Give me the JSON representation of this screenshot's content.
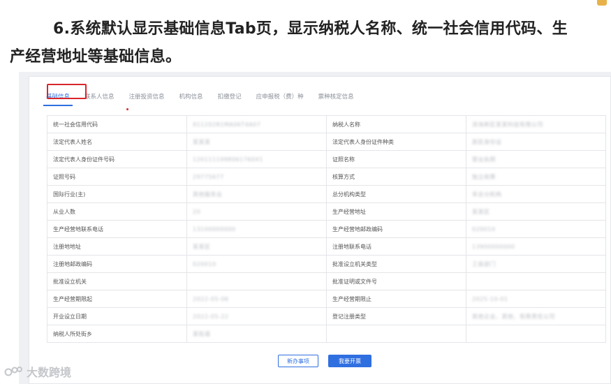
{
  "heading": {
    "line1": "6.系统默认显示基础信息Tab页，显示纳税人名称、统一社会信用代码、生",
    "line2": "产经营地址等基础信息。"
  },
  "tabs": [
    {
      "label": "基础信息",
      "active": true
    },
    {
      "label": "联系人信息",
      "active": false
    },
    {
      "label": "注册投资信息",
      "active": false
    },
    {
      "label": "机构信息",
      "active": false
    },
    {
      "label": "扣缴登记",
      "active": false
    },
    {
      "label": "应申报税（费）种",
      "active": false
    },
    {
      "label": "票种核定信息",
      "active": false
    }
  ],
  "table": {
    "rows": [
      {
        "l1": "统一社会信用代码",
        "v1": "91120281MA06T4A07",
        "l2": "纳税人名称",
        "v2": "滨海新区某某科技有限公司"
      },
      {
        "l1": "法定代表人姓名",
        "v1": "某某某",
        "l2": "法定代表人身份证件种类",
        "v2": "居民身份证"
      },
      {
        "l1": "法定代表人身份证件号码",
        "v1": "1201111998061760X1",
        "l2": "证照名称",
        "v2": "营业执照"
      },
      {
        "l1": "证照号码",
        "v1": "29775677",
        "l2": "核算方式",
        "v2": "独立核算"
      },
      {
        "l1": "国际行业(主)",
        "v1": "其他服务业",
        "l2": "总分机构类型",
        "v2": "非总分机构"
      },
      {
        "l1": "从业人数",
        "v1": "20",
        "l2": "生产经营地址",
        "v2": "某某区"
      },
      {
        "l1": "生产经营地联系电话",
        "v1": "13100000000",
        "l2": "生产经营地邮政编码",
        "v2": "020010"
      },
      {
        "l1": "注册地地址",
        "v1": "某某区",
        "l2": "注册地联系电话",
        "v2": "13900000000"
      },
      {
        "l1": "注册地邮政编码",
        "v1": "020010",
        "l2": "批准设立机关类型",
        "v2": "工商部门"
      },
      {
        "l1": "批准设立机关",
        "v1": "",
        "l2": "批准证明或文件号",
        "v2": ""
      },
      {
        "l1": "生产经营期限起",
        "v1": "2022-05-06",
        "l2": "生产经营期限止",
        "v2": "2025-10-01"
      },
      {
        "l1": "开业设立日期",
        "v1": "2022-05-22",
        "l2": "登记注册类型",
        "v2": "其他企业、其他、有限责任公司"
      },
      {
        "l1": "纳税人所处街乡",
        "v1": "某街道",
        "l2": "",
        "v2": ""
      }
    ]
  },
  "buttons": {
    "secondary": "新办事项",
    "primary": "我要开票"
  },
  "watermark": {
    "text": "大数跨境"
  }
}
